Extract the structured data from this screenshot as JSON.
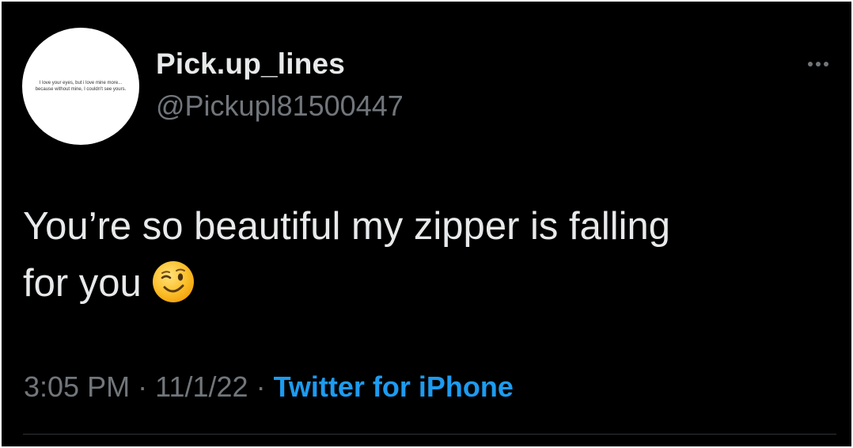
{
  "tweet": {
    "avatar_text_line1": "I love your eyes, but i love mine more...",
    "avatar_text_line2": "because without mine, I couldn't see yours.",
    "display_name": "Pick.up_lines",
    "handle": "@Pickupl81500447",
    "text_line1": "You’re so beautiful my zipper is falling",
    "text_line2": "for you",
    "emoji": "winking-face",
    "time": "3:05 PM",
    "separator": "·",
    "date": "11/1/22",
    "source": "Twitter for iPhone"
  },
  "colors": {
    "background": "#000000",
    "text": "#e7e9ea",
    "muted": "#71767b",
    "link": "#1d9bf0",
    "divider": "#2f3336"
  }
}
